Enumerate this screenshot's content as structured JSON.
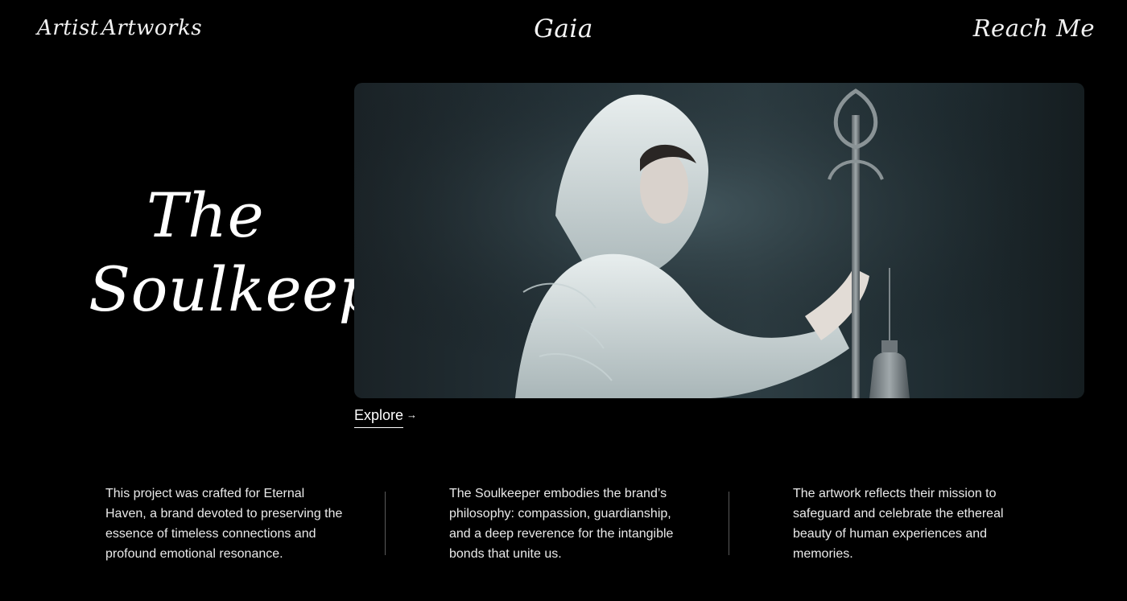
{
  "nav": {
    "artist": "Artist",
    "artworks": "Artworks",
    "brand": "Gaia",
    "reach": "Reach Me"
  },
  "hero": {
    "title_line1": "The",
    "title_line2": "Soulkeeper",
    "image_alt": "Hooded woman in white robe holding an ornate staff with a hanging lantern",
    "explore_label": "Explore",
    "explore_icon": "arrow-right-icon"
  },
  "descriptions": [
    "This project was crafted for Eternal Haven, a brand devoted to preserving the essence of timeless connections and profound emotional resonance.",
    "The Soulkeeper embodies the brand’s philosophy: compassion, guardianship, and a deep reverence for the intangible bonds that unite us.",
    "The artwork reflects their mission to safeguard and celebrate the ethereal beauty of human experiences and memories."
  ],
  "colors": {
    "background": "#000000",
    "text": "#ffffff",
    "divider": "#5a5a5a"
  }
}
